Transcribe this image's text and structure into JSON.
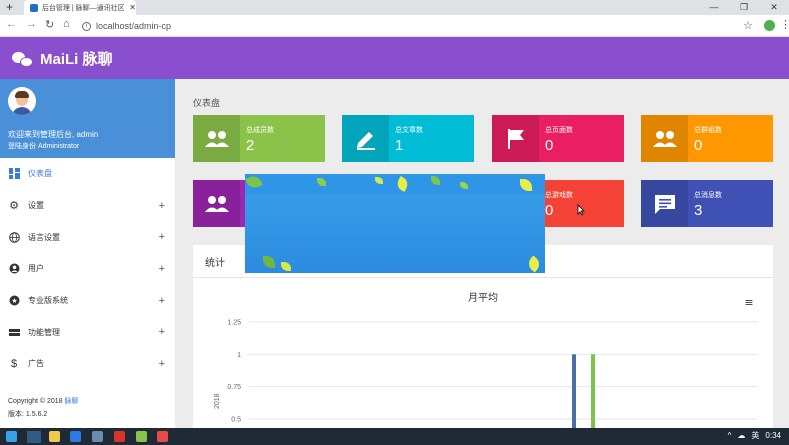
{
  "browser": {
    "tab_title": "后台管理 | 脉聊—通讯社区",
    "url": "localhost/admin-cp"
  },
  "app": {
    "brand": "MaiLi 脉聊",
    "brand_color": "#8a4fcf"
  },
  "user": {
    "welcome": "欢迎来到管理后台, admin",
    "role": "登陆身份 Administrator"
  },
  "menu": [
    {
      "label": "仪表盘",
      "icon": "dashboard-icon",
      "active": true
    },
    {
      "label": "设置",
      "icon": "gear-icon",
      "expandable": true
    },
    {
      "label": "语言设置",
      "icon": "globe-icon",
      "expandable": true
    },
    {
      "label": "用户",
      "icon": "user-icon",
      "expandable": true
    },
    {
      "label": "专业版系统",
      "icon": "star-icon",
      "expandable": true
    },
    {
      "label": "功能管理",
      "icon": "list-icon",
      "expandable": true
    },
    {
      "label": "广告",
      "icon": "dollar-icon",
      "expandable": true
    }
  ],
  "footer": {
    "copyright": "Copyright © 2018",
    "copyright_link": "脉聊",
    "version": "版本: 1.5.6.2"
  },
  "breadcrumb": "仪表盘",
  "stats": [
    {
      "label": "总成员数",
      "value": "2",
      "color": "#8bc34a",
      "icon": "users-icon"
    },
    {
      "label": "总文章数",
      "value": "1",
      "color": "#00bcd4",
      "icon": "pencil-icon"
    },
    {
      "label": "总页面数",
      "value": "0",
      "color": "#e91e63",
      "icon": "flag-icon"
    },
    {
      "label": "总群组数",
      "value": "0",
      "color": "#ff9800",
      "icon": "group-icon"
    },
    {
      "label": "",
      "value": "",
      "color": "#9c27b0",
      "icon": "users-icon"
    },
    {
      "label": "总游戏数",
      "value": "0",
      "color": "#f44336",
      "icon": "game-icon"
    },
    {
      "label": "总消息数",
      "value": "3",
      "color": "#3f51b5",
      "icon": "message-icon"
    }
  ],
  "panel": {
    "title": "统计"
  },
  "chart_data": {
    "type": "bar",
    "title": "月平均",
    "ylabel": "2018",
    "ylim": [
      0.5,
      1.25
    ],
    "yticks": [
      "1.25",
      "1",
      "0.75",
      "0.5"
    ],
    "series": [
      {
        "values": [
          1
        ],
        "color": "#4a6fa5"
      },
      {
        "values": [
          1
        ],
        "color": "#7cc34a"
      }
    ]
  },
  "taskbar": {
    "ime": "英",
    "time": "0:34"
  }
}
